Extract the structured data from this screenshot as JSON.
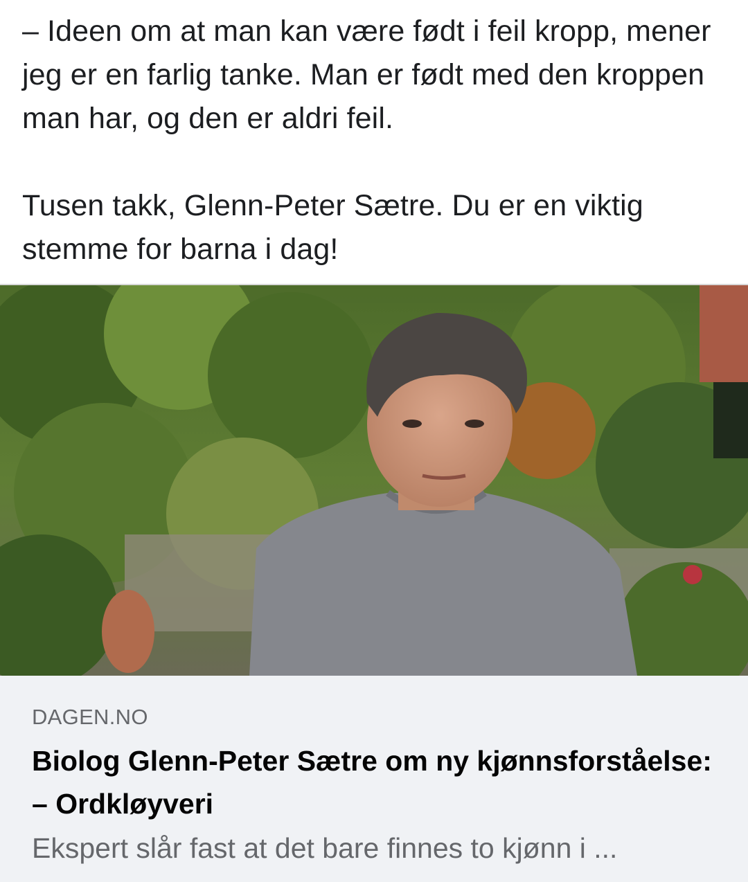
{
  "post": {
    "quote_line": "– Ideen om at man kan være født i feil kropp, mener jeg er en farlig tanke. Man er født med den kroppen man har, og den er aldri feil.",
    "thanks_line": "Tusen takk, Glenn-Peter Sætre. Du er en viktig stemme for barna i dag!"
  },
  "link_preview": {
    "image_icon": "photo-of-man-in-garden",
    "domain": "DAGEN.NO",
    "headline": "Biolog Glenn-Peter Sætre om ny kjønnsforståelse: – Ordkløyveri",
    "description": "Ekspert slår fast at det bare finnes to kjønn i ..."
  },
  "colors": {
    "text": "#1c1e21",
    "meta_background": "#f0f2f5",
    "muted_text": "#65676b"
  }
}
